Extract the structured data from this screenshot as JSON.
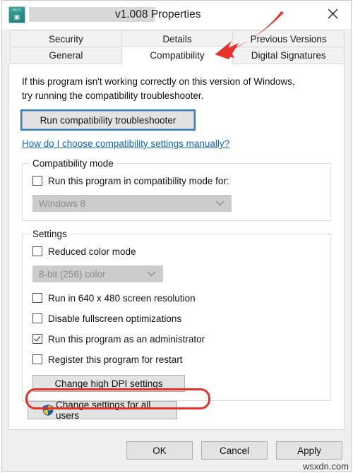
{
  "window": {
    "title_suffix": "v1.008 Properties",
    "app_name_redacted": true,
    "icon_label": "HEIC",
    "close_label": "Close"
  },
  "tabs": {
    "row1": [
      {
        "label": "Security",
        "selected": false
      },
      {
        "label": "Details",
        "selected": false
      },
      {
        "label": "Previous Versions",
        "selected": false
      }
    ],
    "row2": [
      {
        "label": "General",
        "selected": false
      },
      {
        "label": "Compatibility",
        "selected": true
      },
      {
        "label": "Digital Signatures",
        "selected": false
      }
    ]
  },
  "compatibility_tab": {
    "intro_line1": "If this program isn't working correctly on this version of Windows,",
    "intro_line2": "try running the compatibility troubleshooter.",
    "troubleshoot_button": "Run compatibility troubleshooter",
    "help_link": "How do I choose compatibility settings manually?",
    "compatibility_mode": {
      "legend": "Compatibility mode",
      "checkbox_label": "Run this program in compatibility mode for:",
      "checkbox_checked": false,
      "dropdown_value": "Windows 8",
      "dropdown_disabled": true
    },
    "settings": {
      "legend": "Settings",
      "reduced_color_label": "Reduced color mode",
      "reduced_color_checked": false,
      "color_depth_value": "8-bit (256) color",
      "color_depth_disabled": true,
      "checkboxes": [
        {
          "label": "Run in 640 x 480 screen resolution",
          "checked": false
        },
        {
          "label": "Disable fullscreen optimizations",
          "checked": false
        },
        {
          "label": "Run this program as an administrator",
          "checked": true,
          "highlighted": true
        },
        {
          "label": "Register this program for restart",
          "checked": false
        }
      ],
      "dpi_button": "Change high DPI settings"
    },
    "all_users_button": "Change settings for all users"
  },
  "footer": {
    "ok": "OK",
    "cancel": "Cancel",
    "apply": "Apply"
  },
  "annotations": {
    "arrow_color": "#e8312a",
    "highlight_color": "#e8312a",
    "watermark": "wsxdn.com"
  }
}
